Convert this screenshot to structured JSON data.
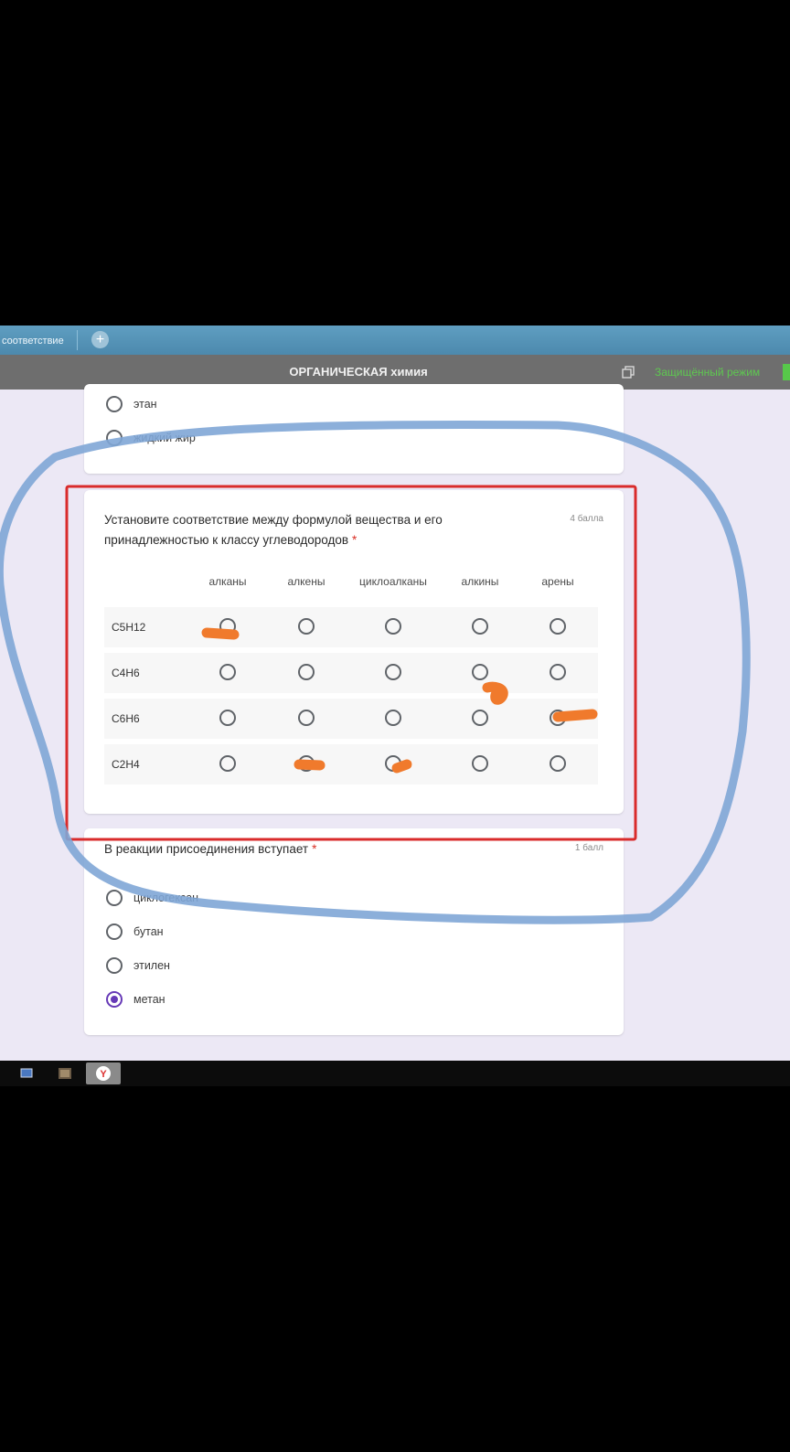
{
  "browser": {
    "tab_label": "соответствие",
    "new_tab_symbol": "+",
    "window_title": "ОРГАНИЧЕСКАЯ химия",
    "protected_mode": "Защищённый режим",
    "protected_color": "#5ec850"
  },
  "prev_question": {
    "options": [
      {
        "label": "этан",
        "selected": false
      },
      {
        "label": "жидкий жир",
        "selected": false
      }
    ]
  },
  "grid_question": {
    "title": "Установите соответствие между формулой вещества и его принадлежностью к классу углеводородов",
    "required_mark": "*",
    "points": "4 балла",
    "columns": [
      "алканы",
      "алкены",
      "циклоалканы",
      "алкины",
      "арены"
    ],
    "rows": [
      "C5H12",
      "C4H6",
      "C6H6",
      "C2H4"
    ],
    "marked_answers": {
      "C5H12": "алканы",
      "C4H6": "алкины",
      "C6H6": "арены",
      "C2H4": "алкены, циклоалканы"
    }
  },
  "next_question": {
    "title": "В реакции присоединения вступает",
    "required_mark": "*",
    "points": "1 балл",
    "options": [
      {
        "label": "циклогексан",
        "selected": false
      },
      {
        "label": "бутан",
        "selected": false
      },
      {
        "label": "этилен",
        "selected": false
      },
      {
        "label": "метан",
        "selected": true
      }
    ]
  },
  "colors": {
    "accent": "#673ab7",
    "required": "#d93025",
    "highlight_box": "#d92b2b",
    "scribble": "#f07a2c",
    "circle_annotation": "#7fa6d6"
  }
}
